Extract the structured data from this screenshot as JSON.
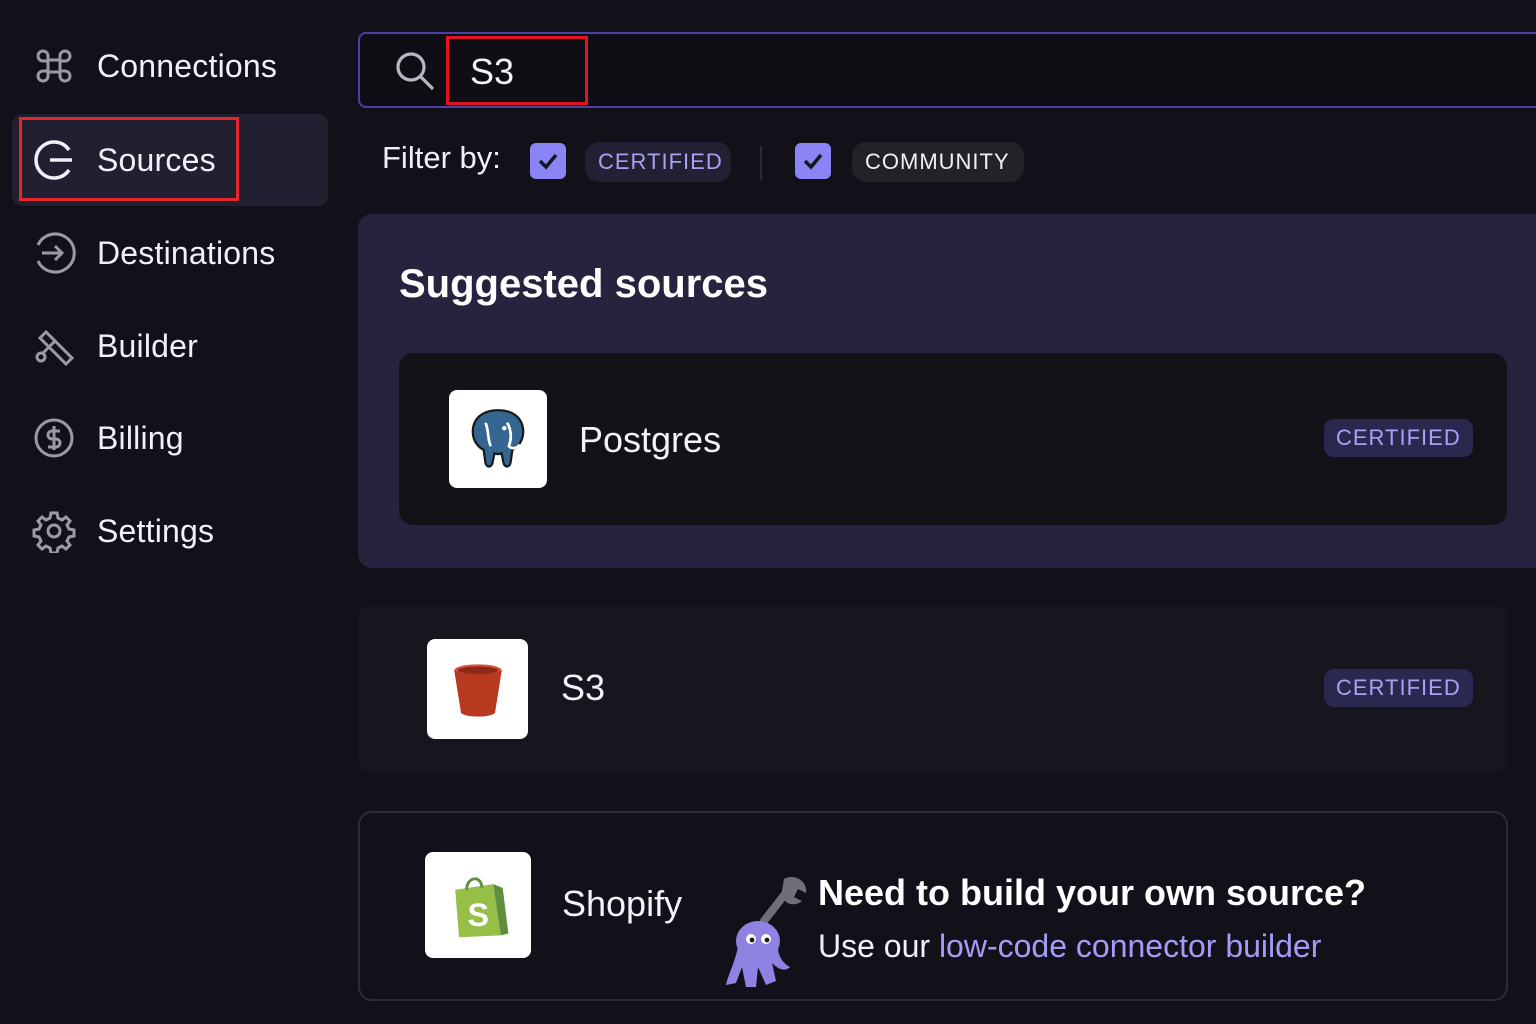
{
  "sidebar": {
    "items": [
      {
        "label": "Connections",
        "icon": "command-icon"
      },
      {
        "label": "Sources",
        "icon": "sources-icon",
        "active": true
      },
      {
        "label": "Destinations",
        "icon": "arrow-circle-icon"
      },
      {
        "label": "Builder",
        "icon": "builder-tools-icon"
      },
      {
        "label": "Billing",
        "icon": "dollar-circle-icon"
      },
      {
        "label": "Settings",
        "icon": "gear-icon"
      }
    ]
  },
  "search": {
    "value": "S3"
  },
  "filter": {
    "label": "Filter by:",
    "certified": {
      "label": "CERTIFIED",
      "checked": true
    },
    "community": {
      "label": "COMMUNITY",
      "checked": true
    }
  },
  "suggested": {
    "title": "Suggested sources",
    "items": [
      {
        "name": "Postgres",
        "badge": "CERTIFIED",
        "icon": "postgres-elephant-icon"
      }
    ]
  },
  "results": [
    {
      "name": "S3",
      "badge": "CERTIFIED",
      "icon": "s3-bucket-icon"
    },
    {
      "name": "Shopify",
      "icon": "shopify-bag-icon"
    }
  ],
  "builder_promo": {
    "title": "Need to build your own source?",
    "prefix": "Use our ",
    "link": "low-code connector builder"
  },
  "colors": {
    "background": "#121119",
    "accent": "#8b84f4",
    "panel": "#26233f",
    "highlight": "#e5262b"
  }
}
